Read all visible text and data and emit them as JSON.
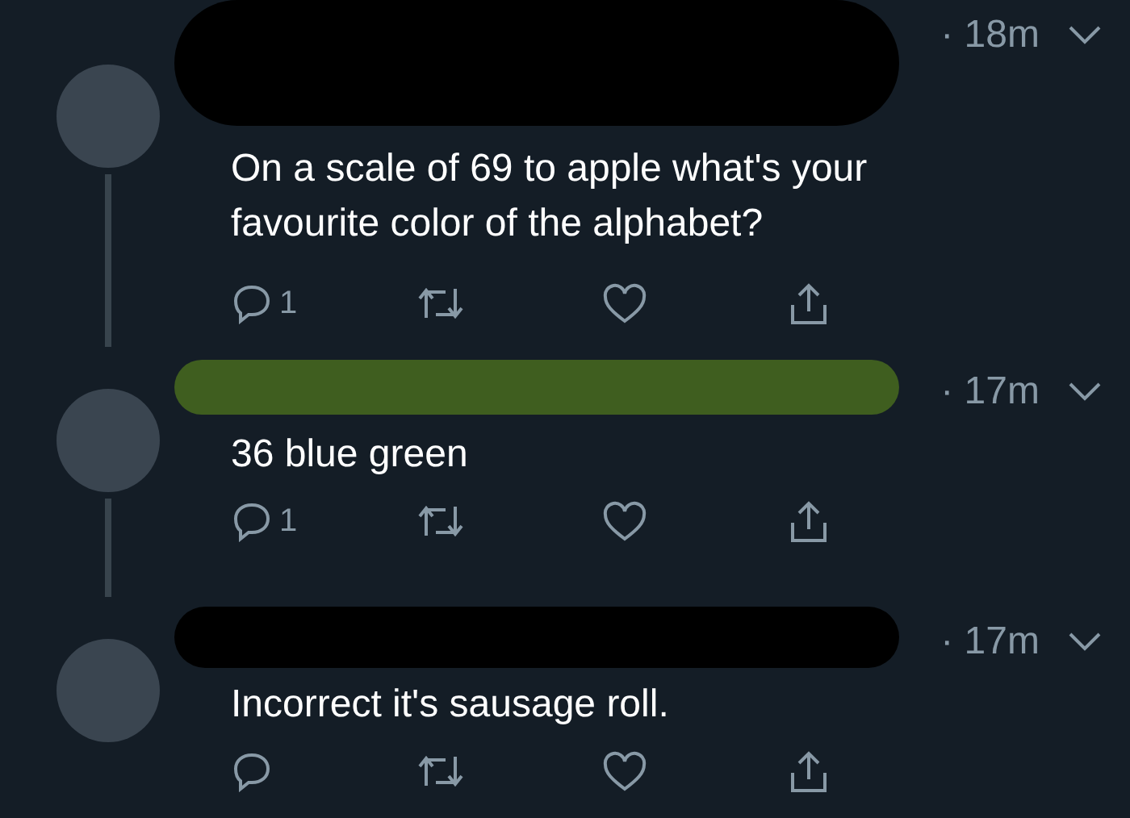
{
  "tweets": [
    {
      "time": "· 18m",
      "text": "On a scale of 69 to apple what's your favourite color of the alphabet?",
      "reply_count": "1",
      "color": "#000000",
      "thread_line": true
    },
    {
      "time": "· 17m",
      "text": "36 blue green",
      "reply_count": "1",
      "color": "#3f5e1f",
      "thread_line": true
    },
    {
      "time": "· 17m",
      "text": "Incorrect it's sausage roll.",
      "color": "#000000",
      "thread_line": false
    }
  ]
}
